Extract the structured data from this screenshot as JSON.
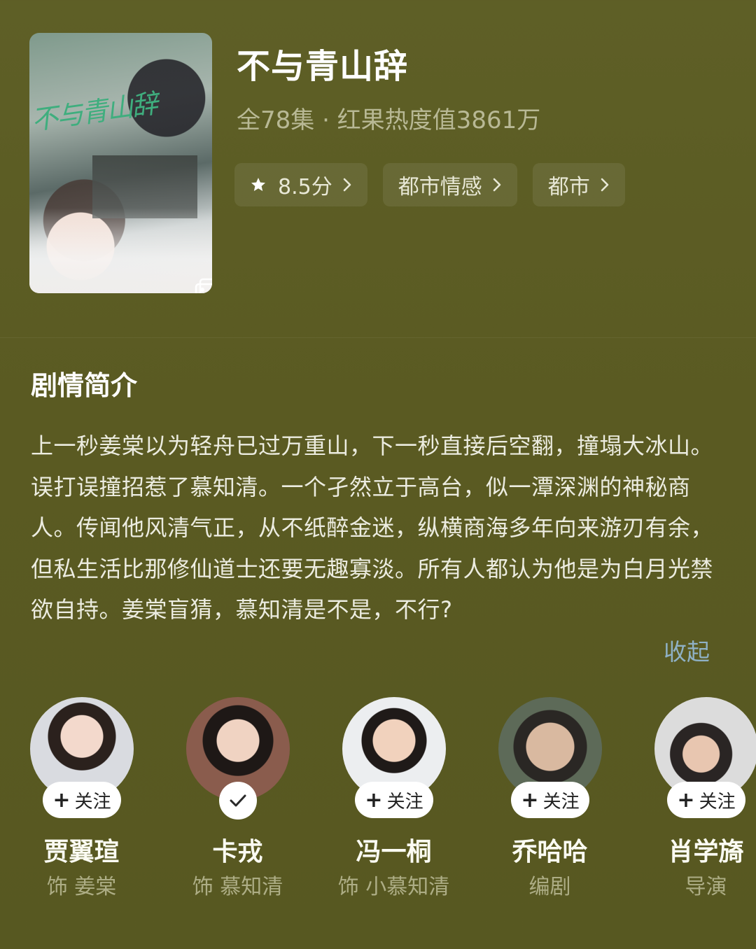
{
  "drama": {
    "poster_title_art": "不与青山辞",
    "title": "不与青山辞",
    "subtitle": "全78集 · 红果热度值3861万",
    "tags": [
      {
        "label": "8.5分",
        "icon": "star-icon"
      },
      {
        "label": "都市情感"
      },
      {
        "label": "都市"
      }
    ]
  },
  "synopsis": {
    "section_title": "剧情简介",
    "text": "上一秒姜棠以为轻舟已过万重山，下一秒直接后空翻，撞塌大冰山。误打误撞招惹了慕知清。一个孑然立于高台，似一潭深渊的神秘商人。传闻他风清气正，从不纸醉金迷，纵横商海多年向来游刃有余，但私生活比那修仙道士还要无趣寡淡。所有人都认为他是为白月光禁欲自持。姜棠盲猜，慕知清是不是，不行?",
    "collapse_label": "收起"
  },
  "cast": [
    {
      "name": "贾翼瑄",
      "role": "饰 姜棠",
      "follow_label": "关注",
      "followed": false
    },
    {
      "name": "卡戎",
      "role": "饰 慕知清",
      "follow_label": "",
      "followed": true
    },
    {
      "name": "冯一桐",
      "role": "饰 小慕知清",
      "follow_label": "关注",
      "followed": false
    },
    {
      "name": "乔哈哈",
      "role": "编剧",
      "follow_label": "关注",
      "followed": false
    },
    {
      "name": "肖学旖",
      "role": "导演",
      "follow_label": "关注",
      "followed": false
    }
  ],
  "colors": {
    "background": "#5b5c24",
    "chip_bg": "rgba(255,255,255,0.08)",
    "link": "#8fb1c6"
  }
}
